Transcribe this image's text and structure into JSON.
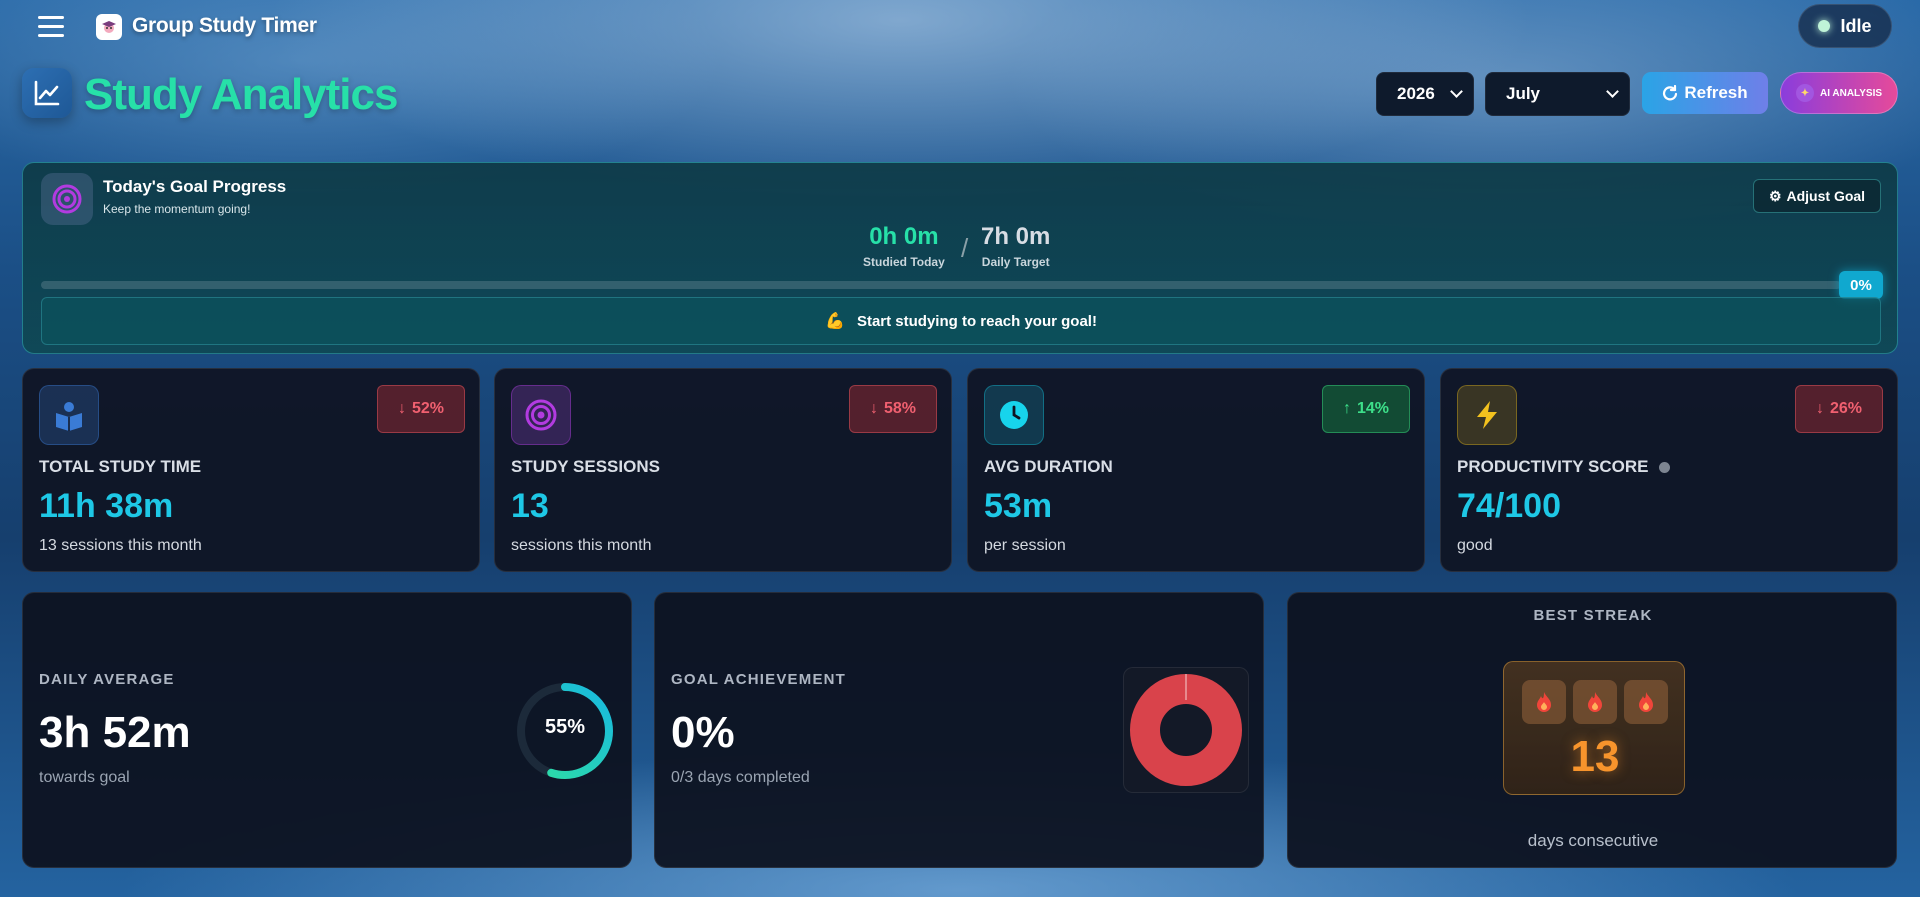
{
  "header": {
    "app_title": "Group Study Timer",
    "status_label": "Idle",
    "menu_icon": "hamburger-menu-icon",
    "logo_icon": "graduate-logo-icon"
  },
  "page": {
    "title": "Study Analytics",
    "title_icon": "line-chart-icon",
    "year_select": {
      "value": "2026"
    },
    "month_select": {
      "value": "July"
    },
    "refresh_label": "Refresh",
    "ai_label": "AI ANALYSIS"
  },
  "goal": {
    "title": "Today's Goal Progress",
    "subtitle": "Keep the momentum going!",
    "adjust_label": "Adjust Goal",
    "studied_value": "0h 0m",
    "studied_label": "Studied Today",
    "separator": "/",
    "target_value": "7h 0m",
    "target_label": "Daily Target",
    "progress_percent": 0,
    "progress_label": "0%",
    "message_emoji": "💪",
    "message": "Start studying to reach your goal!"
  },
  "stats": [
    {
      "label": "TOTAL STUDY TIME",
      "value": "11h 38m",
      "sub": "13 sessions this month",
      "change": "52%",
      "direction": "down",
      "icon": "book-reader-icon",
      "color": "#3a7bd5"
    },
    {
      "label": "STUDY SESSIONS",
      "value": "13",
      "sub": "sessions this month",
      "change": "58%",
      "direction": "down",
      "icon": "target-icon",
      "color": "#b23be0"
    },
    {
      "label": "AVG DURATION",
      "value": "53m",
      "sub": "per session",
      "change": "14%",
      "direction": "up",
      "icon": "clock-icon",
      "color": "#17d4ec"
    },
    {
      "label": "PRODUCTIVITY SCORE",
      "value": "74/100",
      "sub": "good",
      "change": "26%",
      "direction": "down",
      "icon": "lightning-icon",
      "color": "#f3c21e"
    }
  ],
  "daily_average": {
    "label": "DAILY AVERAGE",
    "value": "3h 52m",
    "sub": "towards goal",
    "percent": 55,
    "percent_label": "55%"
  },
  "goal_achievement": {
    "label": "GOAL ACHIEVEMENT",
    "value": "0%",
    "sub": "0/3 days completed",
    "achieved_fraction": 0,
    "color": "#d9434b"
  },
  "best_streak": {
    "title": "BEST STREAK",
    "value": "13",
    "sub": "days consecutive",
    "flame_count": 3
  }
}
